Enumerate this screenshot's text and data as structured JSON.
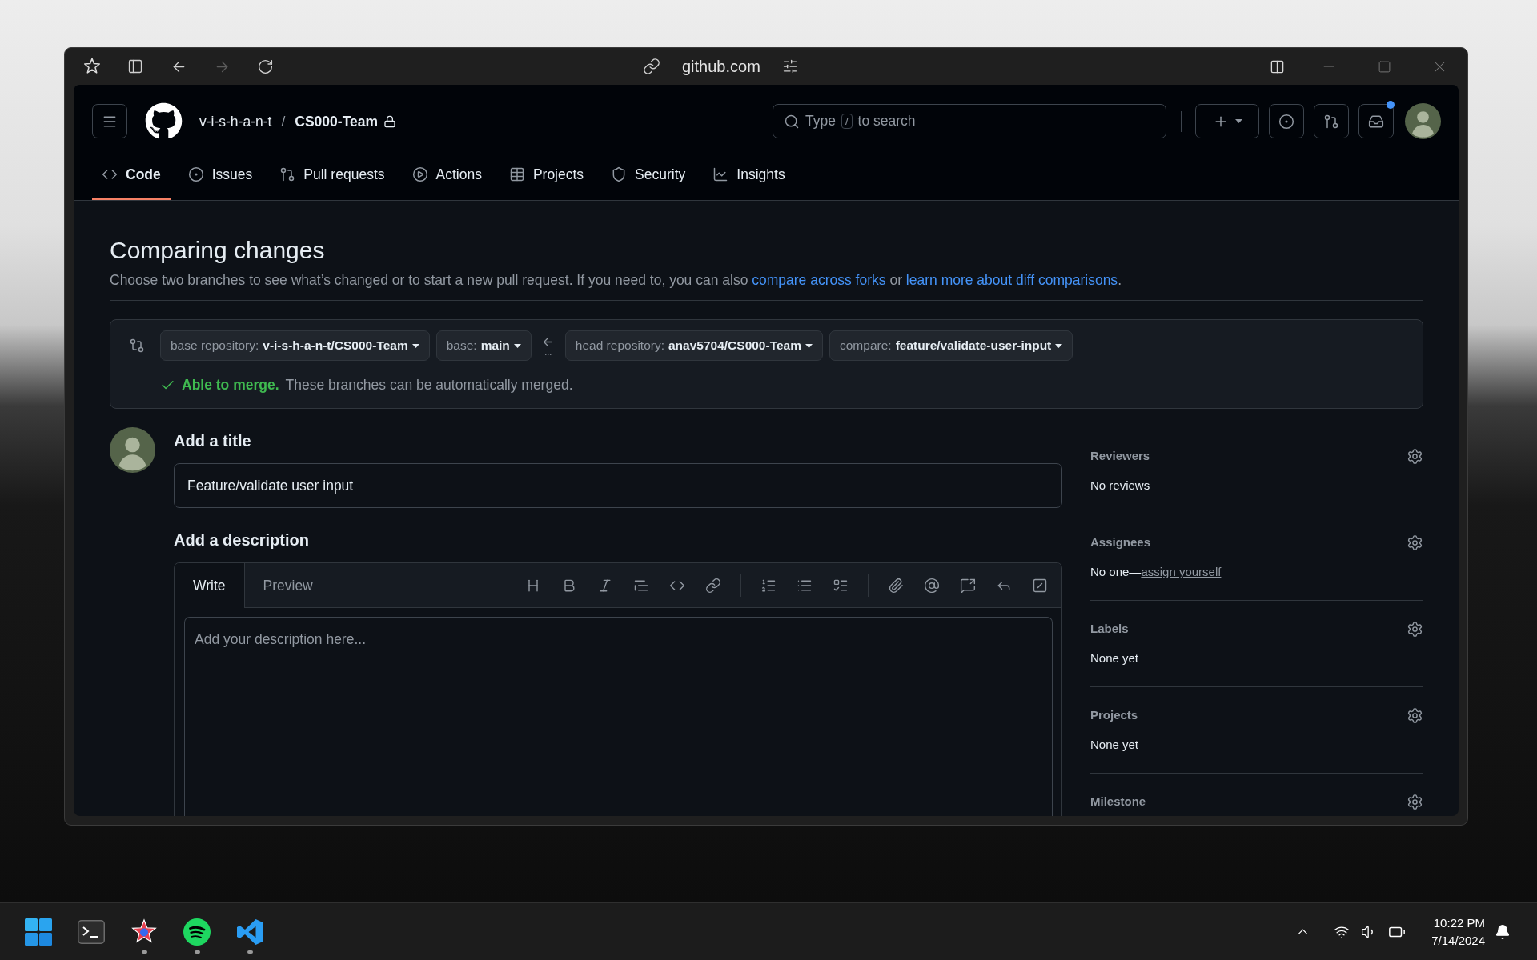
{
  "browser": {
    "url": "github.com",
    "nav_buttons": [
      {
        "disabled": false
      },
      {
        "disabled": true
      },
      {
        "disabled": false
      }
    ]
  },
  "header": {
    "owner": "v-i-s-h-a-n-t",
    "separator": "/",
    "repo": "CS000-Team",
    "private": true,
    "search": {
      "before_key": "Type",
      "key": "/",
      "after_key": "to search"
    },
    "unread_notifications": true
  },
  "repo_tabs": [
    {
      "label": "Code",
      "selected": true
    },
    {
      "label": "Issues",
      "selected": false
    },
    {
      "label": "Pull requests",
      "selected": false
    },
    {
      "label": "Actions",
      "selected": false
    },
    {
      "label": "Projects",
      "selected": false
    },
    {
      "label": "Security",
      "selected": false
    },
    {
      "label": "Insights",
      "selected": false
    }
  ],
  "compare": {
    "title": "Comparing changes",
    "intro": {
      "before": "Choose two branches to see what’s changed or to start a new pull request. If you need to, you can also",
      "forks_link": "compare across forks",
      "between": "or",
      "docs_link": "learn more about diff comparisons",
      "after": "."
    },
    "base": [
      {
        "label": "base repository:",
        "value": "v-i-s-h-a-n-t/CS000-Team"
      },
      {
        "label": "base:",
        "value": "main"
      }
    ],
    "range_dots": "...",
    "head": [
      {
        "label": "head repository:",
        "value": "anav5704/CS000-Team"
      },
      {
        "label": "compare:",
        "value": "feature/validate-user-input"
      }
    ],
    "merge": {
      "mergeable": true,
      "headline": "Able to merge.",
      "detail": "These branches can be automatically merged."
    }
  },
  "pull_request_form": {
    "title_heading": "Add a title",
    "title_value": "Feature/validate user input",
    "description_heading": "Add a description",
    "editor_tabs": [
      {
        "label": "Write",
        "selected": true
      },
      {
        "label": "Preview",
        "selected": false
      }
    ],
    "description_placeholder": "Add your description here..."
  },
  "sidebar": [
    {
      "label": "Reviewers",
      "value": "No reviews"
    },
    {
      "label": "Assignees",
      "value": "No one—",
      "link": "assign yourself"
    },
    {
      "label": "Labels",
      "value": "None yet"
    },
    {
      "label": "Projects",
      "value": "None yet"
    },
    {
      "label": "Milestone"
    }
  ],
  "taskbar": {
    "apps": [
      {
        "running": false
      },
      {
        "running": false
      },
      {
        "running": true
      },
      {
        "running": true
      },
      {
        "running": true
      }
    ],
    "time": "10:22 PM",
    "date": "7/14/2024"
  }
}
